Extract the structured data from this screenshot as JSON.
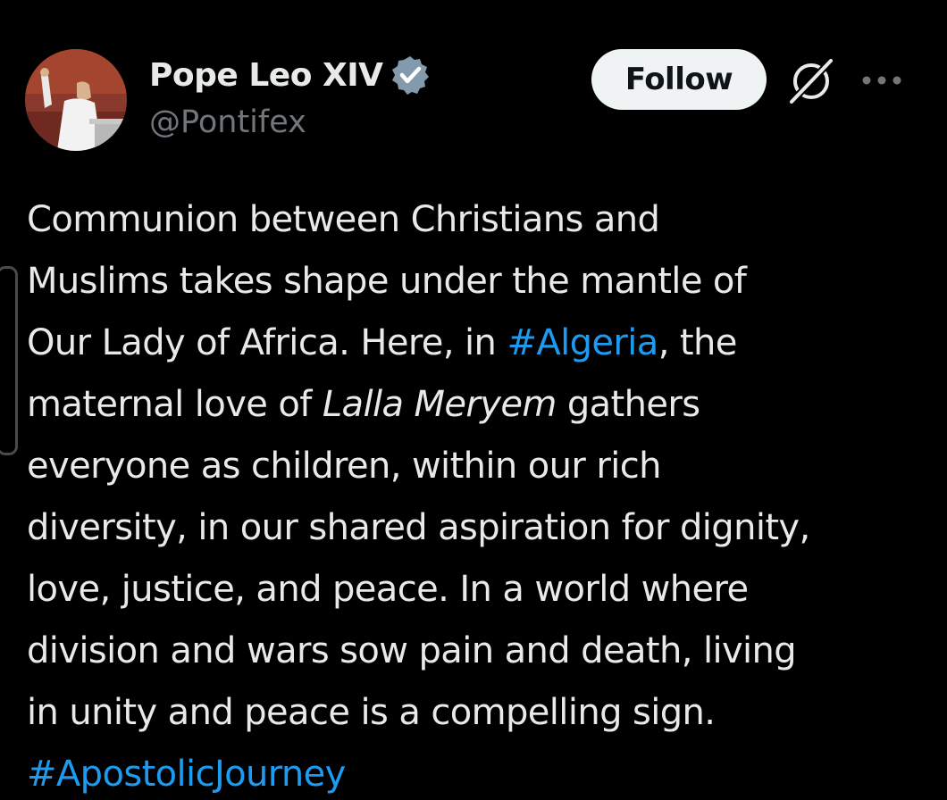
{
  "colors": {
    "background": "#000000",
    "text_primary": "#e7e9ea",
    "text_secondary": "#71767b",
    "link": "#1d9bf0",
    "verified_badge": "#829aab",
    "follow_bg": "#eff3f4"
  },
  "author": {
    "display_name": "Pope Leo XIV",
    "handle": "@Pontifex",
    "verified_icon": "verified-badge-icon"
  },
  "actions": {
    "follow_label": "Follow",
    "grok_icon": "grok-icon",
    "more_icon": "more-icon"
  },
  "tweet": {
    "lines": [
      {
        "segments": [
          {
            "text": "Communion between Christians and"
          }
        ]
      },
      {
        "segments": [
          {
            "text": "Muslims takes shape under the mantle of"
          }
        ]
      },
      {
        "segments": [
          {
            "text": "Our Lady of Africa. Here, in "
          },
          {
            "text": "#Algeria",
            "hashtag": true
          },
          {
            "text": ", the"
          }
        ]
      },
      {
        "segments": [
          {
            "text": "maternal love of "
          },
          {
            "text": "Lalla Meryem",
            "italic": true
          },
          {
            "text": " gathers"
          }
        ]
      },
      {
        "segments": [
          {
            "text": "everyone as children, within our rich"
          }
        ]
      },
      {
        "segments": [
          {
            "text": "diversity, in our shared aspiration for dignity,"
          }
        ]
      },
      {
        "segments": [
          {
            "text": "love, justice, and peace. In a world where"
          }
        ]
      },
      {
        "segments": [
          {
            "text": "division and wars sow pain and death, living"
          }
        ]
      },
      {
        "segments": [
          {
            "text": "in unity and peace is a compelling sign."
          }
        ]
      },
      {
        "segments": [
          {
            "text": "#ApostolicJourney",
            "hashtag": true
          }
        ]
      }
    ]
  }
}
